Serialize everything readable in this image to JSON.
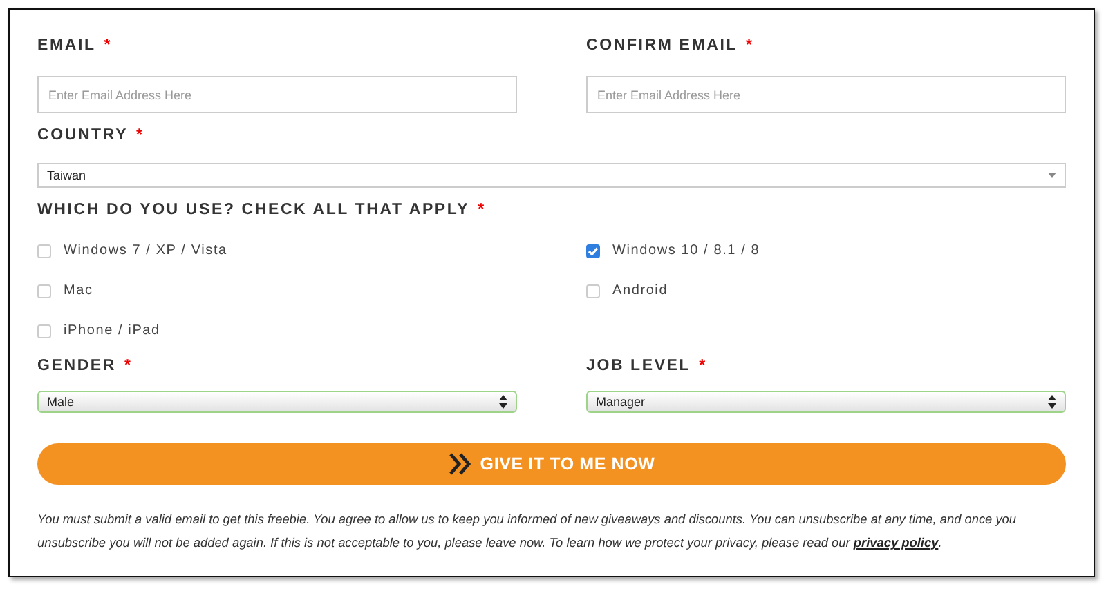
{
  "email_fields": [
    {
      "label": "EMAIL",
      "required_mark": "*",
      "placeholder": "Enter Email Address Here"
    },
    {
      "label": "CONFIRM EMAIL",
      "required_mark": "*",
      "placeholder": "Enter Email Address Here"
    }
  ],
  "country": {
    "label": "COUNTRY",
    "required_mark": "*",
    "value": "Taiwan",
    "kind": "flat"
  },
  "platforms": {
    "label": "WHICH DO YOU USE? CHECK ALL THAT APPLY",
    "required_mark": "*",
    "options": [
      {
        "label": "Windows 7 / XP / Vista",
        "checked": false
      },
      {
        "label": "Windows 10 / 8.1 / 8",
        "checked": true
      },
      {
        "label": "Mac",
        "checked": false
      },
      {
        "label": "Android",
        "checked": false
      },
      {
        "label": "iPhone / iPad",
        "checked": false
      }
    ]
  },
  "selects": [
    {
      "label": "GENDER",
      "required_mark": "*",
      "value": "Male",
      "kind": "native"
    },
    {
      "label": "JOB LEVEL",
      "required_mark": "*",
      "value": "Manager",
      "kind": "native"
    }
  ],
  "submit_button": {
    "label": "GIVE IT TO ME NOW"
  },
  "disclaimer": {
    "text": "You must submit a valid email to get this freebie. You agree to allow us to keep you informed of new giveaways and discounts. You can unsubscribe at any time, and once you unsubscribe you will not be added again. If this is not acceptable to you, please leave now. To learn how we protect your privacy, please read our ",
    "link": "privacy policy",
    "end": "."
  }
}
